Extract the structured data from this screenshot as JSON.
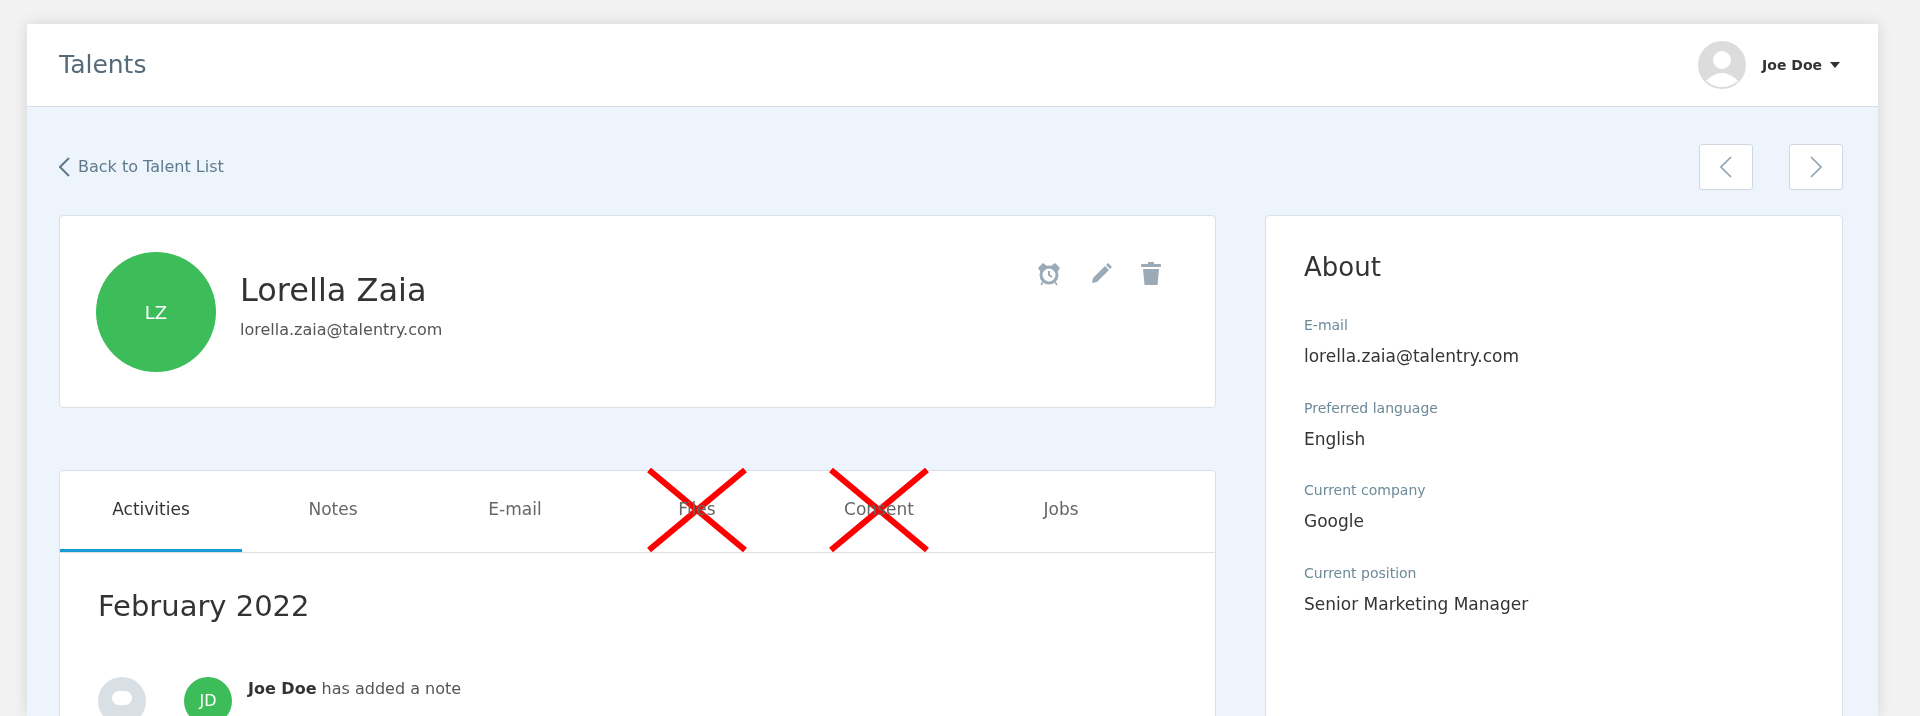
{
  "header": {
    "title": "Talents",
    "user": {
      "name": "Joe Doe"
    }
  },
  "back_link": "Back to Talent List",
  "profile": {
    "initials": "LZ",
    "name": "Lorella Zaia",
    "email": "lorella.zaia@talentry.com"
  },
  "tabs": [
    {
      "label": "Activities",
      "selected": true,
      "crossed": false
    },
    {
      "label": "Notes",
      "selected": false,
      "crossed": false
    },
    {
      "label": "E-mail",
      "selected": false,
      "crossed": false
    },
    {
      "label": "Files",
      "selected": false,
      "crossed": true
    },
    {
      "label": "Consent",
      "selected": false,
      "crossed": true
    },
    {
      "label": "Jobs",
      "selected": false,
      "crossed": false
    }
  ],
  "activities": {
    "month": "February 2022",
    "items": [
      {
        "initials": "JD",
        "author": "Joe Doe",
        "action": "has added a note"
      }
    ]
  },
  "about": {
    "title": "About",
    "fields": [
      {
        "label": "E-mail",
        "value": "lorella.zaia@talentry.com"
      },
      {
        "label": "Preferred language",
        "value": "English"
      },
      {
        "label": "Current company",
        "value": "Google"
      },
      {
        "label": "Current position",
        "value": "Senior Marketing Manager"
      }
    ]
  }
}
